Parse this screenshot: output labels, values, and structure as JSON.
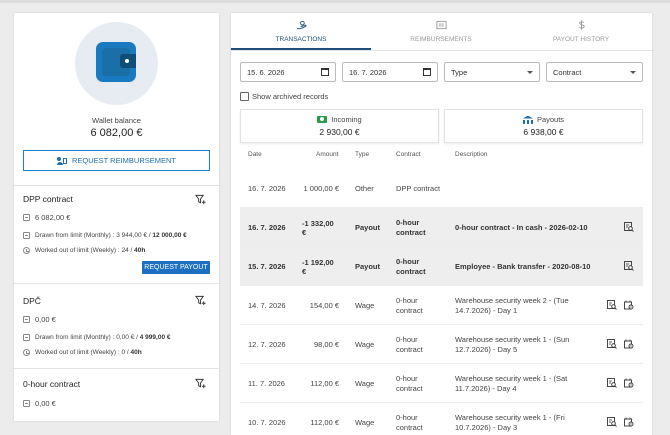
{
  "left": {
    "wallet_label": "Wallet balance",
    "wallet_value": "6 082,00 €",
    "request_button": "Request reimbursement",
    "contracts": [
      {
        "title": "DPP contract",
        "balance": "6 082,00 €",
        "drawn_label": "Drawn from limit (Monthly) : ",
        "drawn_used": "3 944,00 € / ",
        "drawn_limit": "12 000,00 €",
        "worked_label": "Worked out of limit (Weekly) : ",
        "worked_used": "24 / ",
        "worked_limit": "40h",
        "payout_button": "Request payout"
      },
      {
        "title": "DPČ",
        "balance": "0,00 €",
        "drawn_label": "Drawn from limit (Monthly) : ",
        "drawn_used": "0,00 € / ",
        "drawn_limit": "4 999,00 €",
        "worked_label": "Worked out of limit (Weekly) : ",
        "worked_used": "0 / ",
        "worked_limit": "40h"
      },
      {
        "title": "0-hour contract",
        "balance": "0,00 €"
      }
    ]
  },
  "tabs": [
    {
      "label": "Transactions",
      "icon": "hand-coins-icon",
      "active": true
    },
    {
      "label": "Reimbursements",
      "icon": "receipt-icon",
      "active": false
    },
    {
      "label": "Payout history",
      "icon": "dollar-icon",
      "active": false
    }
  ],
  "filters": {
    "date_from": "15. 6. 2026",
    "date_to": "16. 7. 2026",
    "type_placeholder": "Type",
    "contract_placeholder": "Contract",
    "show_archived": "Show archived records"
  },
  "summary": {
    "incoming_label": "Incoming",
    "incoming_value": "2 930,00 €",
    "payouts_label": "Payouts",
    "payouts_value": "6 938,00 €"
  },
  "table": {
    "headers": {
      "date": "Date",
      "amount": "Amount",
      "type": "Type",
      "contract": "Contract",
      "description": "Description"
    },
    "rows": [
      {
        "date": "16. 7. 2026",
        "amount": "1 000,00 €",
        "type": "Other",
        "contract": "DPP contract",
        "description": "",
        "highlight": false,
        "icons": []
      },
      {
        "date": "16. 7. 2026",
        "amount": "-1 332,00 €",
        "type": "Payout",
        "contract": "0-hour contract",
        "description": "0-hour contract - In cash - 2026-02-10",
        "highlight": true,
        "icons": [
          "receipt-search-icon"
        ]
      },
      {
        "date": "15. 7. 2026",
        "amount": "-1 192,00 €",
        "type": "Payout",
        "contract": "0-hour contract",
        "description": "Employee - Bank transfer - 2020-08-10",
        "highlight": true,
        "icons": [
          "receipt-search-icon"
        ]
      },
      {
        "date": "14. 7. 2026",
        "amount": "154,00 €",
        "type": "Wage",
        "contract": "0-hour contract",
        "description": "Warehouse security week 2 - (Tue 14.7.2026) - Day 1",
        "highlight": false,
        "icons": [
          "receipt-search-icon",
          "shift-settings-icon"
        ]
      },
      {
        "date": "12. 7. 2026",
        "amount": "98,00 €",
        "type": "Wage",
        "contract": "0-hour contract",
        "description": "Warehouse security week 1 - (Sun 12.7.2026) - Day 5",
        "highlight": false,
        "icons": [
          "receipt-search-icon",
          "shift-settings-icon"
        ]
      },
      {
        "date": "11. 7. 2026",
        "amount": "112,00 €",
        "type": "Wage",
        "contract": "0-hour contract",
        "description": "Warehouse security week 1 - (Sat 11.7.2026) - Day 4",
        "highlight": false,
        "icons": [
          "receipt-search-icon",
          "shift-settings-icon"
        ]
      },
      {
        "date": "10. 7. 2026",
        "amount": "112,00 €",
        "type": "Wage",
        "contract": "0-hour contract",
        "description": "Warehouse security week 1 - (Fri 10.7.2026) - Day 3",
        "highlight": false,
        "icons": [
          "receipt-search-icon",
          "shift-settings-icon"
        ]
      }
    ]
  },
  "colors": {
    "accent": "#1d6fc2",
    "tab_active": "#1d4f7e",
    "highlight_row": "#eeeeee"
  }
}
